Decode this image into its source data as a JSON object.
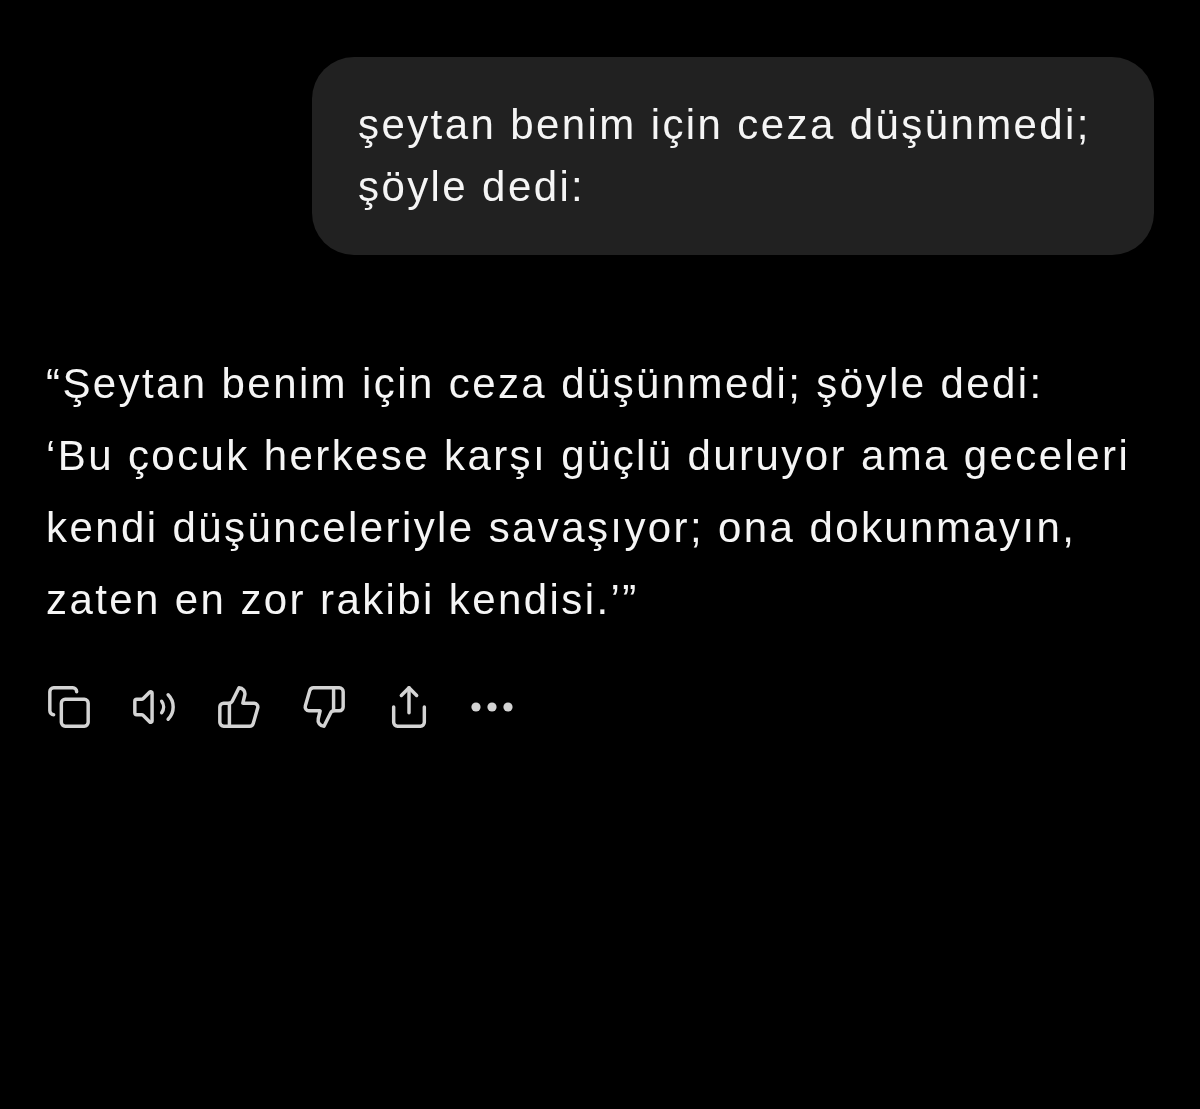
{
  "user_message": {
    "text": "şeytan benim için ceza düşünmedi; şöyle dedi:"
  },
  "assistant_message": {
    "text": "“Şeytan benim için ceza düşünmedi; şöyle dedi:\n‘Bu çocuk herkese karşı güçlü duruyor ama geceleri kendi düşünceleriyle savaşıyor; ona dokunmayın, zaten en zor rakibi kendisi.’”"
  }
}
